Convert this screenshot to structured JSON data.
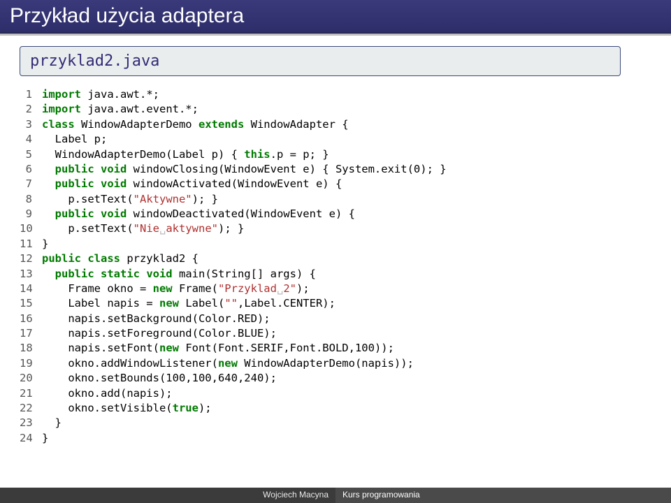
{
  "title": "Przykład użycia adaptera",
  "filebox": "przyklad2.java",
  "footer": {
    "author": "Wojciech Macyna",
    "course": "Kurs programowania"
  },
  "code": [
    {
      "n": 1,
      "tokens": [
        [
          "kw",
          "import"
        ],
        [
          "plain",
          " java.awt.*;"
        ]
      ]
    },
    {
      "n": 2,
      "tokens": [
        [
          "kw",
          "import"
        ],
        [
          "plain",
          " java.awt.event.*;"
        ]
      ]
    },
    {
      "n": 3,
      "tokens": [
        [
          "kw",
          "class"
        ],
        [
          "plain",
          " WindowAdapterDemo "
        ],
        [
          "kw",
          "extends"
        ],
        [
          "plain",
          " WindowAdapter {"
        ]
      ]
    },
    {
      "n": 4,
      "tokens": [
        [
          "plain",
          "  Label p;"
        ]
      ]
    },
    {
      "n": 5,
      "tokens": [
        [
          "plain",
          "  WindowAdapterDemo(Label p) { "
        ],
        [
          "kw",
          "this"
        ],
        [
          "plain",
          ".p = p; }"
        ]
      ]
    },
    {
      "n": 6,
      "tokens": [
        [
          "plain",
          "  "
        ],
        [
          "kw",
          "public void"
        ],
        [
          "plain",
          " windowClosing(WindowEvent e) { System.exit(0); }"
        ]
      ]
    },
    {
      "n": 7,
      "tokens": [
        [
          "plain",
          "  "
        ],
        [
          "kw",
          "public void"
        ],
        [
          "plain",
          " windowActivated(WindowEvent e) {"
        ]
      ]
    },
    {
      "n": 8,
      "tokens": [
        [
          "plain",
          "    p.setText("
        ],
        [
          "str",
          "\"Aktywne\""
        ],
        [
          "plain",
          "); }"
        ]
      ]
    },
    {
      "n": 9,
      "tokens": [
        [
          "plain",
          "  "
        ],
        [
          "kw",
          "public void"
        ],
        [
          "plain",
          " windowDeactivated(WindowEvent e) {"
        ]
      ]
    },
    {
      "n": 10,
      "tokens": [
        [
          "plain",
          "    p.setText("
        ],
        [
          "str",
          "\"Nie"
        ],
        [
          "vs",
          "␣"
        ],
        [
          "str",
          "aktywne\""
        ],
        [
          "plain",
          "); }"
        ]
      ]
    },
    {
      "n": 11,
      "tokens": [
        [
          "plain",
          "}"
        ]
      ]
    },
    {
      "n": 12,
      "tokens": [
        [
          "kw",
          "public class"
        ],
        [
          "plain",
          " przyklad2 {"
        ]
      ]
    },
    {
      "n": 13,
      "tokens": [
        [
          "plain",
          "  "
        ],
        [
          "kw",
          "public static void"
        ],
        [
          "plain",
          " main(String[] args) {"
        ]
      ]
    },
    {
      "n": 14,
      "tokens": [
        [
          "plain",
          "    Frame okno = "
        ],
        [
          "kw",
          "new"
        ],
        [
          "plain",
          " Frame("
        ],
        [
          "str",
          "\"Przyklad"
        ],
        [
          "vs",
          "␣"
        ],
        [
          "str",
          "2\""
        ],
        [
          "plain",
          ");"
        ]
      ]
    },
    {
      "n": 15,
      "tokens": [
        [
          "plain",
          "    Label napis = "
        ],
        [
          "kw",
          "new"
        ],
        [
          "plain",
          " Label("
        ],
        [
          "str",
          "\"\""
        ],
        [
          "plain",
          ",Label.CENTER);"
        ]
      ]
    },
    {
      "n": 16,
      "tokens": [
        [
          "plain",
          "    napis.setBackground(Color.RED);"
        ]
      ]
    },
    {
      "n": 17,
      "tokens": [
        [
          "plain",
          "    napis.setForeground(Color.BLUE);"
        ]
      ]
    },
    {
      "n": 18,
      "tokens": [
        [
          "plain",
          "    napis.setFont("
        ],
        [
          "kw",
          "new"
        ],
        [
          "plain",
          " Font(Font.SERIF,Font.BOLD,100));"
        ]
      ]
    },
    {
      "n": 19,
      "tokens": [
        [
          "plain",
          "    okno.addWindowListener("
        ],
        [
          "kw",
          "new"
        ],
        [
          "plain",
          " WindowAdapterDemo(napis));"
        ]
      ]
    },
    {
      "n": 20,
      "tokens": [
        [
          "plain",
          "    okno.setBounds(100,100,640,240);"
        ]
      ]
    },
    {
      "n": 21,
      "tokens": [
        [
          "plain",
          "    okno.add(napis);"
        ]
      ]
    },
    {
      "n": 22,
      "tokens": [
        [
          "plain",
          "    okno.setVisible("
        ],
        [
          "kw",
          "true"
        ],
        [
          "plain",
          ");"
        ]
      ]
    },
    {
      "n": 23,
      "tokens": [
        [
          "plain",
          "  }"
        ]
      ]
    },
    {
      "n": 24,
      "tokens": [
        [
          "plain",
          "}"
        ]
      ]
    }
  ]
}
